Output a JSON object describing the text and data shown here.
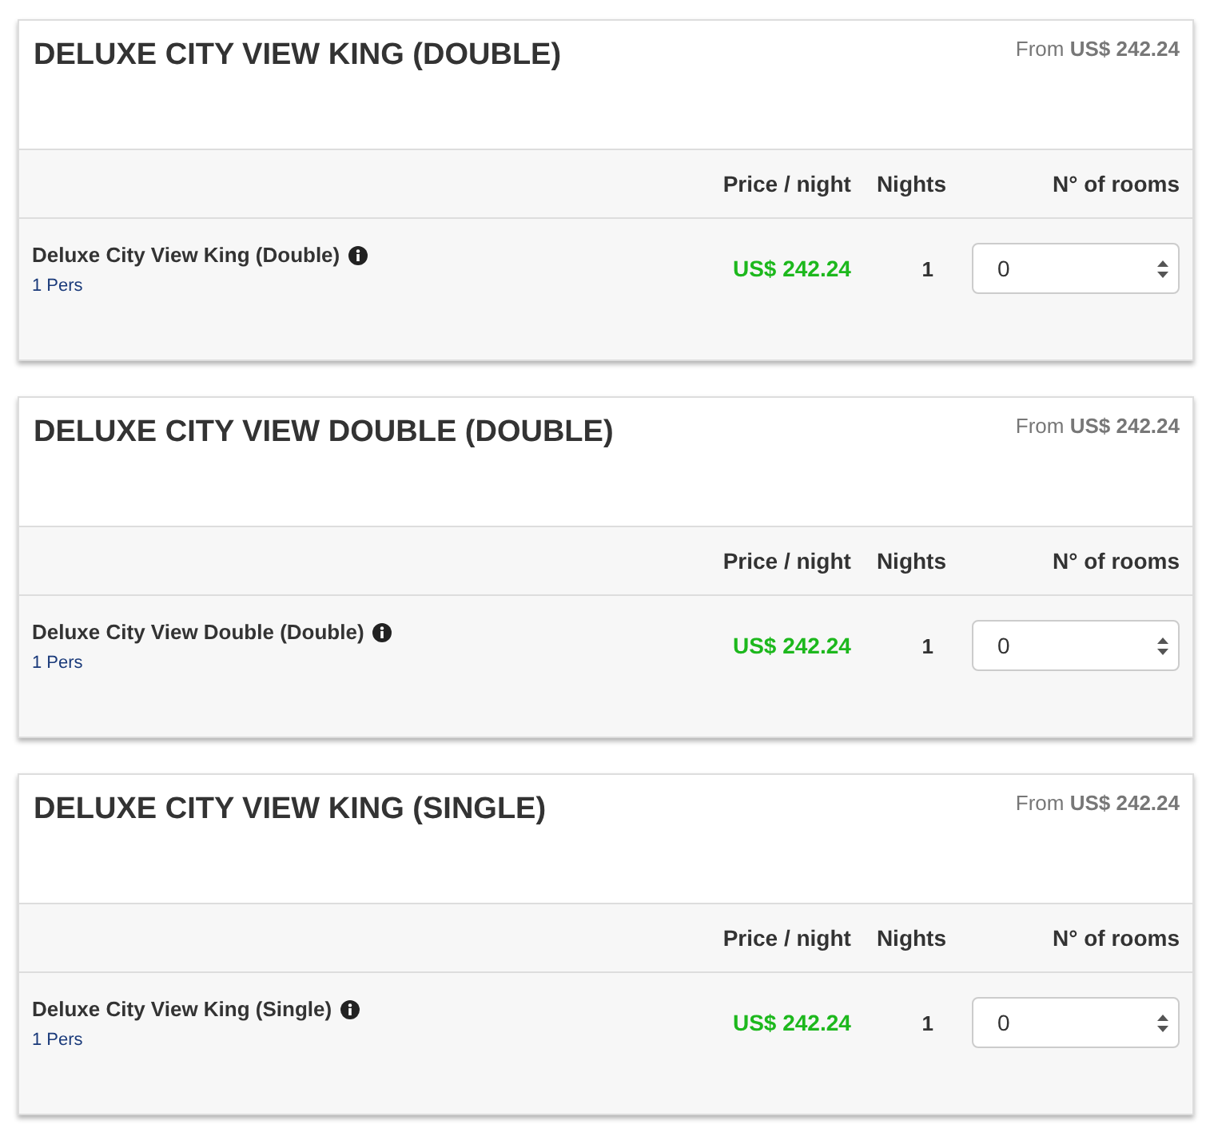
{
  "rooms": [
    {
      "title": "DELUXE CITY VIEW KING (DOUBLE)",
      "from_price": "From **US$ 242.24**",
      "columns": [
        "Price / night",
        "Nights",
        "N° of rooms"
      ],
      "rate": {
        "name": "Deluxe City View King (Double)",
        "occupancy": "1 Pers",
        "price": "US$ 242.24",
        "nights": "1",
        "rooms_value": "0"
      }
    },
    {
      "title": "DELUXE CITY VIEW DOUBLE (DOUBLE)",
      "from_price": "From **US$ 242.24**",
      "columns": [
        "Price / night",
        "Nights",
        "N° of rooms"
      ],
      "rate": {
        "name": "Deluxe City View Double (Double)",
        "occupancy": "1 Pers",
        "price": "US$ 242.24",
        "nights": "1",
        "rooms_value": "0"
      }
    },
    {
      "title": "DELUXE CITY VIEW KING (SINGLE)",
      "from_price": "From **US$ 242.24**",
      "columns": [
        "Price / night",
        "Nights",
        "N° of rooms"
      ],
      "rate": {
        "name": "Deluxe City View King (Single)",
        "occupancy": "1 Pers",
        "price": "US$ 242.24",
        "nights": "1",
        "rooms_value": "0"
      }
    }
  ]
}
